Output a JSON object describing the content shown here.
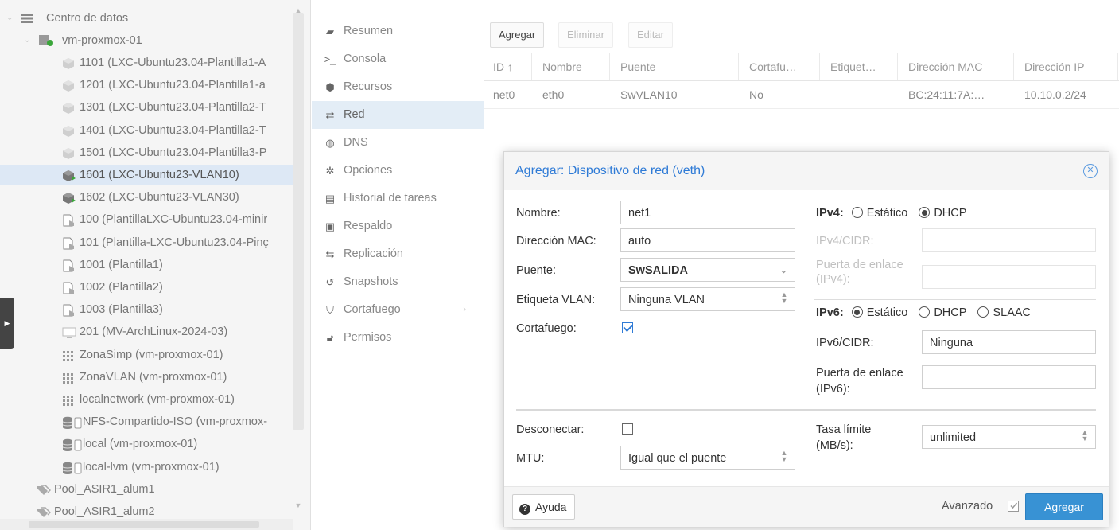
{
  "tree": {
    "datacenter": "Centro de datos",
    "node": "vm-proxmox-01",
    "items": [
      {
        "label": "1101 (LXC-Ubuntu23.04-Plantilla1-A",
        "icon": "container-icon"
      },
      {
        "label": "1201 (LXC-Ubuntu23.04-Plantilla1-a",
        "icon": "container-icon"
      },
      {
        "label": "1301 (LXC-Ubuntu23.04-Plantilla2-T",
        "icon": "container-icon"
      },
      {
        "label": "1401 (LXC-Ubuntu23.04-Plantilla2-T",
        "icon": "container-icon"
      },
      {
        "label": "1501 (LXC-Ubuntu23.04-Plantilla3-P",
        "icon": "container-icon"
      },
      {
        "label": "1601 (LXC-Ubuntu23-VLAN10)",
        "icon": "container-running-icon"
      },
      {
        "label": "1602 (LXC-Ubuntu23-VLAN30)",
        "icon": "container-running-icon"
      },
      {
        "label": "100 (PlantillaLXC-Ubuntu23.04-minir",
        "icon": "template-icon"
      },
      {
        "label": "101 (Plantilla-LXC-Ubuntu23.04-Pinç",
        "icon": "template-icon"
      },
      {
        "label": "1001 (Plantilla1)",
        "icon": "template-icon"
      },
      {
        "label": "1002 (Plantilla2)",
        "icon": "template-icon"
      },
      {
        "label": "1003 (Plantilla3)",
        "icon": "template-icon"
      },
      {
        "label": "201 (MV-ArchLinux-2024-03)",
        "icon": "vm-icon"
      },
      {
        "label": "ZonaSimp (vm-proxmox-01)",
        "icon": "sdn-zone-icon"
      },
      {
        "label": "ZonaVLAN (vm-proxmox-01)",
        "icon": "sdn-zone-icon"
      },
      {
        "label": "localnetwork (vm-proxmox-01)",
        "icon": "sdn-zone-icon"
      },
      {
        "label": "NFS-Compartido-ISO (vm-proxmox-",
        "icon": "storage-icon"
      },
      {
        "label": "local (vm-proxmox-01)",
        "icon": "storage-icon"
      },
      {
        "label": "local-lvm (vm-proxmox-01)",
        "icon": "storage-icon"
      },
      {
        "label": "Pool_ASIR1_alum1",
        "icon": "pool-icon"
      },
      {
        "label": "Pool_ASIR1_alum2",
        "icon": "pool-icon"
      }
    ]
  },
  "menu": [
    {
      "label": "Resumen",
      "icon": "book-icon"
    },
    {
      "label": "Consola",
      "icon": "terminal-icon"
    },
    {
      "label": "Recursos",
      "icon": "cube-icon"
    },
    {
      "label": "Red",
      "icon": "exchange-icon"
    },
    {
      "label": "DNS",
      "icon": "globe-icon"
    },
    {
      "label": "Opciones",
      "icon": "gear-icon"
    },
    {
      "label": "Historial de tareas",
      "icon": "list-icon"
    },
    {
      "label": "Respaldo",
      "icon": "floppy-icon"
    },
    {
      "label": "Replicación",
      "icon": "retweet-icon"
    },
    {
      "label": "Snapshots",
      "icon": "history-icon"
    },
    {
      "label": "Cortafuego",
      "icon": "shield-icon"
    },
    {
      "label": "Permisos",
      "icon": "unlock-icon"
    }
  ],
  "grid": {
    "toolbar": {
      "add": "Agregar",
      "remove": "Eliminar",
      "edit": "Editar"
    },
    "headers": [
      "ID ↑",
      "Nombre",
      "Puente",
      "Cortafu…",
      "Etiquet…",
      "Dirección MAC",
      "Dirección IP"
    ],
    "rows": [
      [
        "net0",
        "eth0",
        "SwVLAN10",
        "No",
        "",
        "BC:24:11:7A:…",
        "10.10.0.2/24"
      ]
    ]
  },
  "dialog": {
    "title": "Agregar: Dispositivo de red (veth)",
    "name_label": "Nombre:",
    "name_value": "net1",
    "mac_label": "Dirección MAC:",
    "mac_value": "auto",
    "bridge_label": "Puente:",
    "bridge_value": "SwSALIDA",
    "vlan_label": "Etiqueta VLAN:",
    "vlan_value": "Ninguna VLAN",
    "firewall_label": "Cortafuego:",
    "ipv4_label": "IPv4:",
    "ipv4_static": "Estático",
    "ipv4_dhcp": "DHCP",
    "ipv4_cidr_label": "IPv4/CIDR:",
    "ipv4_gw_label_1": "Puerta de enlace",
    "ipv4_gw_label_2": "(IPv4):",
    "ipv6_label": "IPv6:",
    "ipv6_static": "Estático",
    "ipv6_dhcp": "DHCP",
    "ipv6_slaac": "SLAAC",
    "ipv6_cidr_label": "IPv6/CIDR:",
    "ipv6_cidr_value": "Ninguna",
    "ipv6_gw_label_1": "Puerta de enlace",
    "ipv6_gw_label_2": "(IPv6):",
    "disconnect_label": "Desconectar:",
    "mtu_label": "MTU:",
    "mtu_value": "Igual que el puente",
    "rate_label_1": "Tasa límite",
    "rate_label_2": "(MB/s):",
    "rate_value": "unlimited",
    "help": "Ayuda",
    "advanced": "Avanzado",
    "submit": "Agregar"
  },
  "colors": {
    "accent": "#3892d4",
    "title": "#2f7bd6",
    "selected_row": "#dde8f5"
  }
}
